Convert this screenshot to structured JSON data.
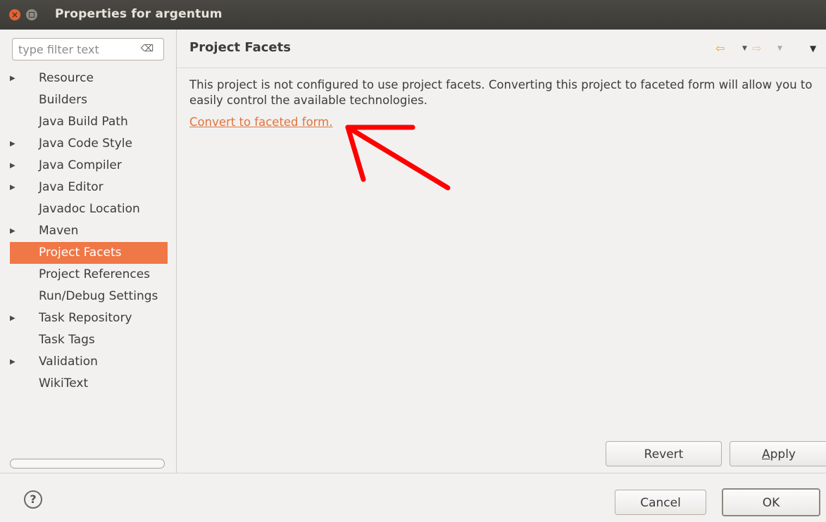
{
  "window": {
    "title": "Properties for argentum"
  },
  "filter": {
    "placeholder": "type filter text",
    "clear_icon": "clear-filter-icon"
  },
  "tree": {
    "items": [
      {
        "label": "Resource",
        "expandable": true,
        "selected": false
      },
      {
        "label": "Builders",
        "expandable": false,
        "selected": false
      },
      {
        "label": "Java Build Path",
        "expandable": false,
        "selected": false
      },
      {
        "label": "Java Code Style",
        "expandable": true,
        "selected": false
      },
      {
        "label": "Java Compiler",
        "expandable": true,
        "selected": false
      },
      {
        "label": "Java Editor",
        "expandable": true,
        "selected": false
      },
      {
        "label": "Javadoc Location",
        "expandable": false,
        "selected": false
      },
      {
        "label": "Maven",
        "expandable": true,
        "selected": false
      },
      {
        "label": "Project Facets",
        "expandable": false,
        "selected": true
      },
      {
        "label": "Project References",
        "expandable": false,
        "selected": false
      },
      {
        "label": "Run/Debug Settings",
        "expandable": false,
        "selected": false
      },
      {
        "label": "Task Repository",
        "expandable": true,
        "selected": false
      },
      {
        "label": "Task Tags",
        "expandable": false,
        "selected": false
      },
      {
        "label": "Validation",
        "expandable": true,
        "selected": false
      },
      {
        "label": "WikiText",
        "expandable": false,
        "selected": false
      }
    ]
  },
  "page": {
    "title": "Project Facets",
    "message": "This project is not configured to use project facets. Converting this project to faceted form will allow you to easily control the available technologies.",
    "convert_link": "Convert to faceted form."
  },
  "buttons": {
    "revert": "Revert",
    "apply_mnemonic": "A",
    "apply_rest": "pply",
    "cancel": "Cancel",
    "ok": "OK"
  },
  "colors": {
    "selection": "#f07746",
    "link": "#e0733c",
    "titlebar": "#3c3b37",
    "annotation_arrow": "#ff0000"
  }
}
